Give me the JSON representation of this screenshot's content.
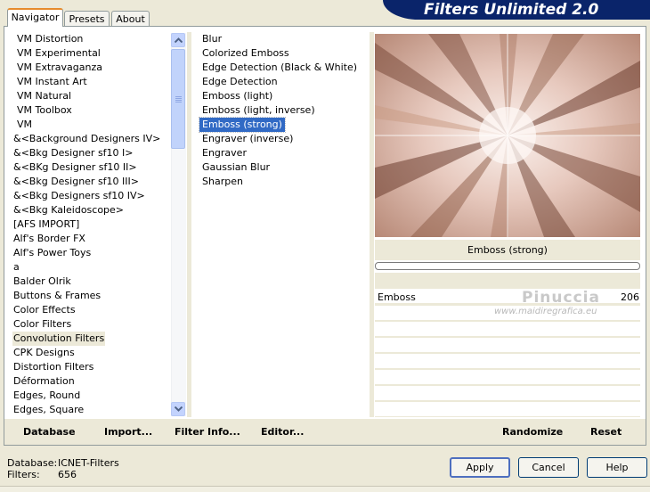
{
  "app": {
    "title": "Filters Unlimited 2.0"
  },
  "tabs": [
    {
      "label": "Navigator",
      "active": true
    },
    {
      "label": "Presets",
      "active": false
    },
    {
      "label": "About",
      "active": false
    }
  ],
  "categories": [
    "VM Distortion",
    "VM Experimental",
    "VM Extravaganza",
    "VM Instant Art",
    "VM Natural",
    "VM Toolbox",
    "VM",
    "&<Background Designers IV>",
    "&<Bkg Designer sf10 I>",
    "&<BKg Designer sf10 II>",
    "&<Bkg Designer sf10 III>",
    "&<Bkg Designers sf10 IV>",
    "&<Bkg Kaleidoscope>",
    "[AFS IMPORT]",
    "Alf's Border FX",
    "Alf's Power Toys",
    "a",
    "Balder Olrik",
    "Buttons & Frames",
    "Color Effects",
    "Color Filters",
    "Convolution Filters",
    "CPK Designs",
    "Distortion Filters",
    "Déformation",
    "Edges, Round",
    "Edges, Square"
  ],
  "selected_category": "Convolution Filters",
  "filters": [
    "Blur",
    "Colorized Emboss",
    "Edge Detection (Black & White)",
    "Edge Detection",
    "Emboss (light)",
    "Emboss (light, inverse)",
    "Emboss (strong)",
    "Engraver (inverse)",
    "Engraver",
    "Gaussian Blur",
    "Sharpen"
  ],
  "selected_filter": "Emboss (strong)",
  "preview": {
    "filter_name": "Emboss (strong)"
  },
  "parameters": [
    {
      "label": "Emboss",
      "value": "206"
    }
  ],
  "watermark": {
    "name": "Pinuccia",
    "site": "www.maidiregrafica.eu"
  },
  "toolbar": {
    "database": "Database",
    "import": "Import...",
    "filter_info": "Filter Info...",
    "editor": "Editor...",
    "randomize": "Randomize",
    "reset": "Reset"
  },
  "status": {
    "database_label": "Database:",
    "database_value": "ICNET-Filters",
    "filters_label": "Filters:",
    "filters_value": "656"
  },
  "buttons": {
    "apply": "Apply",
    "cancel": "Cancel",
    "help": "Help"
  },
  "colors": {
    "selection": "#316ac5",
    "banner": "#0a246a"
  }
}
